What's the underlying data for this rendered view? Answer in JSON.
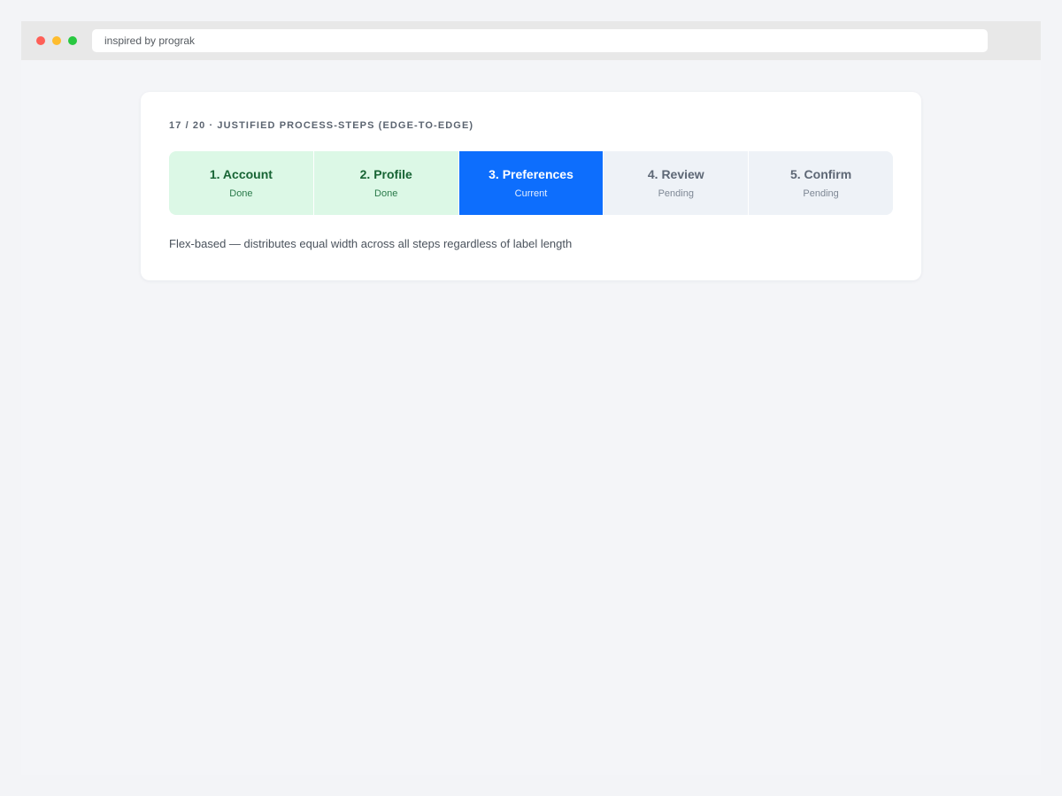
{
  "browser": {
    "address": "inspired by prograk"
  },
  "card": {
    "title": "17 / 20 · JUSTIFIED PROCESS-STEPS (EDGE-TO-EDGE)",
    "caption": "Flex-based — distributes equal width across all steps regardless of label length"
  },
  "steps": [
    {
      "label": "1. Account",
      "status": "Done",
      "state": "done"
    },
    {
      "label": "2. Profile",
      "status": "Done",
      "state": "done"
    },
    {
      "label": "3. Preferences",
      "status": "Current",
      "state": "current"
    },
    {
      "label": "4. Review",
      "status": "Pending",
      "state": "pending"
    },
    {
      "label": "5. Confirm",
      "status": "Pending",
      "state": "pending"
    }
  ],
  "colors": {
    "done_bg": "#dcf8e6",
    "current_bg": "#0d6efd",
    "pending_bg": "#eef2f7"
  }
}
